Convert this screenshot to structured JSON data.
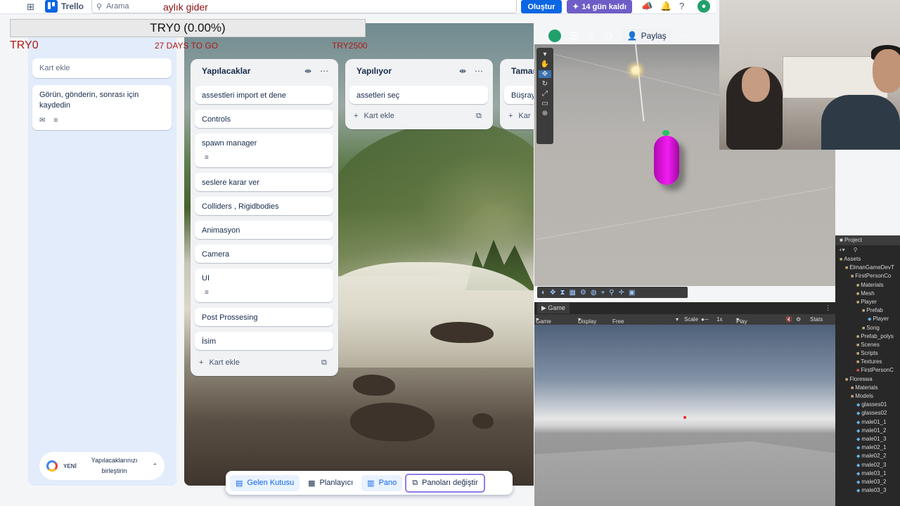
{
  "topbar": {
    "app_name": "Trello",
    "search_placeholder": "Arama",
    "create_label": "Oluştur",
    "trial_label": "14 gün kaldı"
  },
  "overlay": {
    "title": "aylık gider",
    "banner": "TRY0 (0.00%)",
    "amount_left": "TRY0",
    "days_label": "27 DAYS TO GO",
    "goal": "TRY2500"
  },
  "inbox": {
    "title": "Gelen Kutusu",
    "add_card": "Kart ekle",
    "hint": "Görün, gönderin, sonrası için kaydedin",
    "merge_new": "YENİ",
    "merge_text": "Yapılacaklarınızı birleştirin"
  },
  "board": {
    "share_label": "Paylaş",
    "lists": [
      {
        "title": "Yapılacaklar",
        "cards": [
          "assestleri import et dene",
          "Controls",
          "spawn manager",
          "seslere karar ver",
          "Colliders , Rigidbodies",
          "Animasyon",
          "Camera",
          "UI",
          "Post Prossesing",
          "İsim"
        ],
        "add_card": "Kart ekle"
      },
      {
        "title": "Yapılıyor",
        "cards": [
          "assetleri seç"
        ],
        "add_card": "Kart ekle"
      },
      {
        "title": "Taman",
        "cards": [
          "Büşray"
        ],
        "add_card": "Kar"
      }
    ]
  },
  "bottom_nav": {
    "inbox": "Gelen Kutusu",
    "planner": "Planlayıcı",
    "board": "Pano",
    "switch": "Panoları değiştir"
  },
  "unity": {
    "game_tab": "Game",
    "game_toolbar": {
      "mode": "Game",
      "display": "Display 1",
      "aspect": "Free Aspect",
      "scale_label": "Scale",
      "scale_value": "1x",
      "play_mode": "Play Focused",
      "stats": "Stats"
    },
    "project_tab": "Project",
    "project_tree": [
      {
        "name": "Assets",
        "type": "folder",
        "depth": 0
      },
      {
        "name": "ElmanGameDevT",
        "type": "folder",
        "depth": 1
      },
      {
        "name": "FirstPersonCo",
        "type": "folder",
        "depth": 2
      },
      {
        "name": "Materials",
        "type": "folder",
        "depth": 3
      },
      {
        "name": "Mesh",
        "type": "folder",
        "depth": 3
      },
      {
        "name": "Player",
        "type": "folder",
        "depth": 3
      },
      {
        "name": "Prefab",
        "type": "folder",
        "depth": 4
      },
      {
        "name": "Player",
        "type": "prefab",
        "depth": 5
      },
      {
        "name": "Song",
        "type": "folder",
        "depth": 4
      },
      {
        "name": "Prefab_polys",
        "type": "folder",
        "depth": 3
      },
      {
        "name": "Scenes",
        "type": "folder",
        "depth": 3
      },
      {
        "name": "Scripts",
        "type": "folder",
        "depth": 3
      },
      {
        "name": "Textures",
        "type": "folder",
        "depth": 3
      },
      {
        "name": "FirstPersonC",
        "type": "scene",
        "depth": 3
      },
      {
        "name": "Floreswa",
        "type": "folder",
        "depth": 1
      },
      {
        "name": "Materials",
        "type": "folder",
        "depth": 2
      },
      {
        "name": "Models",
        "type": "folder",
        "depth": 2
      },
      {
        "name": "glasses01",
        "type": "prefab",
        "depth": 3
      },
      {
        "name": "glasses02",
        "type": "prefab",
        "depth": 3
      },
      {
        "name": "male01_1",
        "type": "prefab",
        "depth": 3
      },
      {
        "name": "male01_2",
        "type": "prefab",
        "depth": 3
      },
      {
        "name": "male01_3",
        "type": "prefab",
        "depth": 3
      },
      {
        "name": "male02_1",
        "type": "prefab",
        "depth": 3
      },
      {
        "name": "male02_2",
        "type": "prefab",
        "depth": 3
      },
      {
        "name": "male02_3",
        "type": "prefab",
        "depth": 3
      },
      {
        "name": "male03_1",
        "type": "prefab",
        "depth": 3
      },
      {
        "name": "male03_2",
        "type": "prefab",
        "depth": 3
      },
      {
        "name": "male03_3",
        "type": "prefab",
        "depth": 3
      }
    ]
  }
}
